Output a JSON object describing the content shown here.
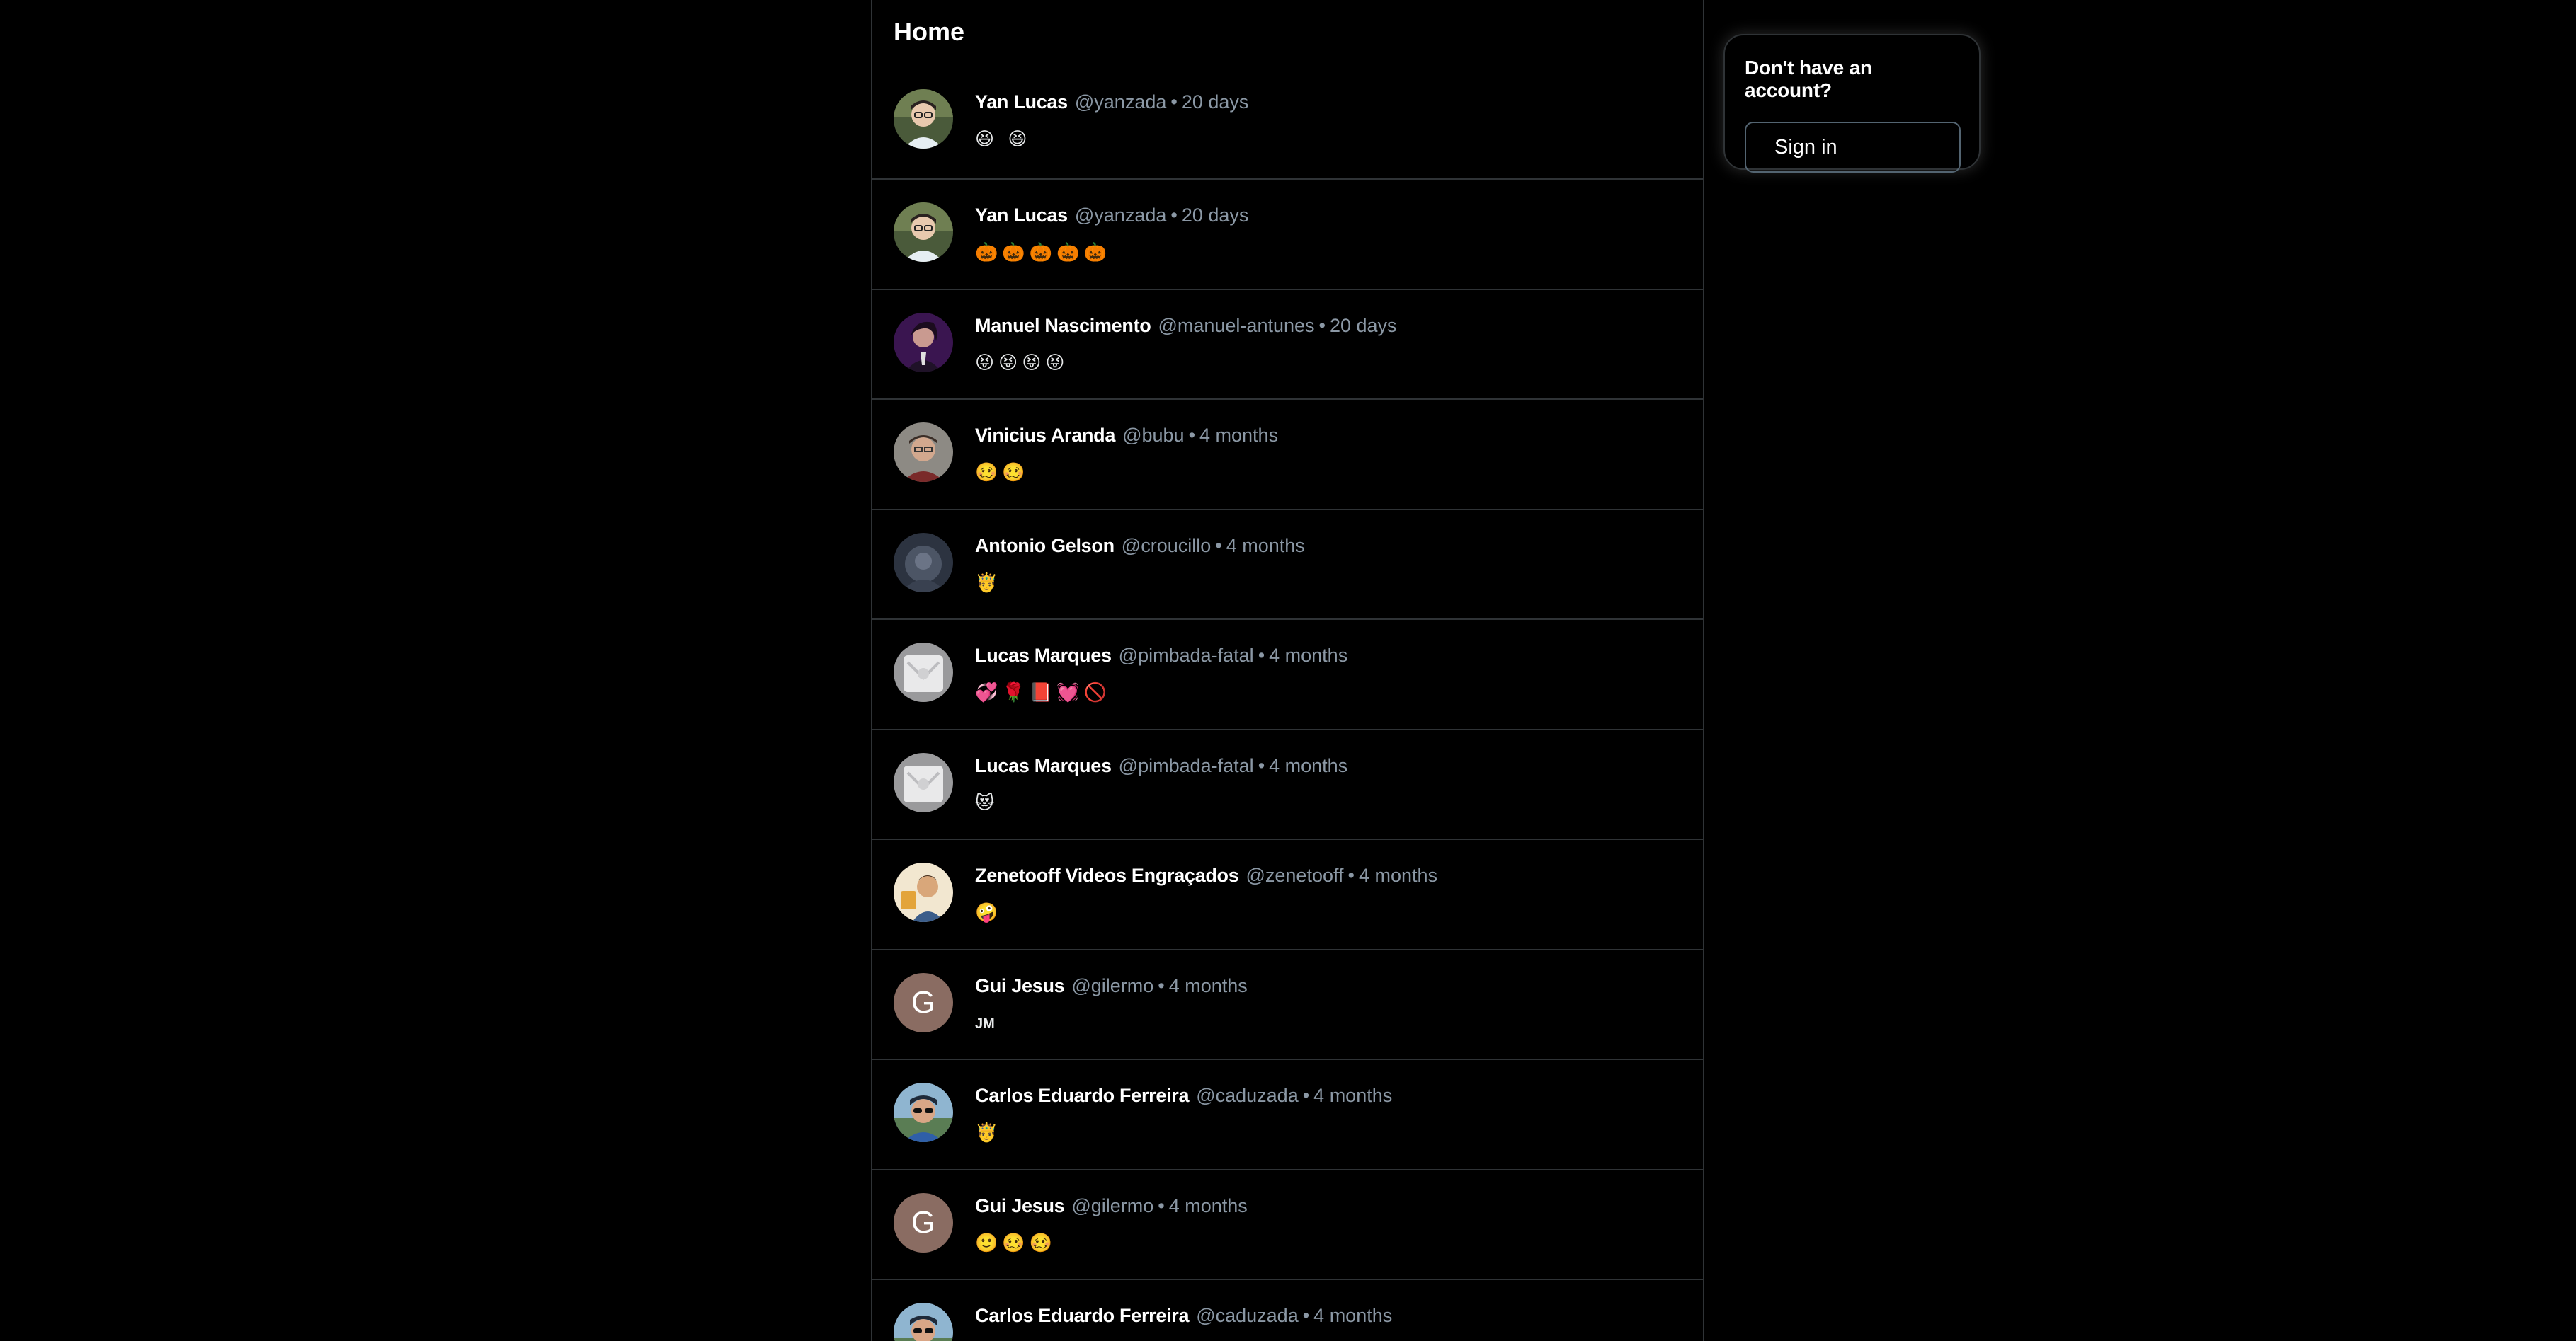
{
  "feed": {
    "title": "Home",
    "posts": [
      {
        "name": "Yan Lucas",
        "handle": "@yanzada",
        "separator": "•",
        "time": "20 days",
        "body": "😆 😆",
        "avatar": "photo-glasses"
      },
      {
        "name": "Yan Lucas",
        "handle": "@yanzada",
        "separator": "•",
        "time": "20 days",
        "body": "🎃🎃🎃🎃🎃",
        "avatar": "photo-glasses"
      },
      {
        "name": "Manuel Nascimento",
        "handle": "@manuel-antunes",
        "separator": "•",
        "time": "20 days",
        "body": "😝😝😝😝",
        "avatar": "photo-purple"
      },
      {
        "name": "Vinicius Aranda",
        "handle": "@bubu",
        "separator": "•",
        "time": "4 months",
        "body": "🥴🥴",
        "avatar": "photo-man"
      },
      {
        "name": "Antonio Gelson",
        "handle": "@croucillo",
        "separator": "•",
        "time": "4 months",
        "body": "🤴",
        "avatar": "photo-dark"
      },
      {
        "name": "Lucas Marques",
        "handle": "@pimbada-fatal",
        "separator": "•",
        "time": "4 months",
        "body": "💞🌹📕💓🚫",
        "avatar": "photo-grey"
      },
      {
        "name": "Lucas Marques",
        "handle": "@pimbada-fatal",
        "separator": "•",
        "time": "4 months",
        "body": "😻",
        "avatar": "photo-grey"
      },
      {
        "name": "Zenetooff Videos Engraçados",
        "handle": "@zenetooff",
        "separator": "•",
        "time": "4 months",
        "body": "🤪",
        "avatar": "photo-bright"
      },
      {
        "name": "Gui Jesus",
        "handle": "@gilermo",
        "separator": "•",
        "time": "4 months",
        "body": "JM",
        "avatar": "letter",
        "avatar_letter": "G",
        "small_text": true
      },
      {
        "name": "Carlos Eduardo Ferreira",
        "handle": "@caduzada",
        "separator": "•",
        "time": "4 months",
        "body": "🤴",
        "avatar": "photo-sunglasses"
      },
      {
        "name": "Gui Jesus",
        "handle": "@gilermo",
        "separator": "•",
        "time": "4 months",
        "body": "🙂🥴🥴",
        "avatar": "letter",
        "avatar_letter": "G"
      },
      {
        "name": "Carlos Eduardo Ferreira",
        "handle": "@caduzada",
        "separator": "•",
        "time": "4 months",
        "body": "",
        "avatar": "photo-sunglasses"
      }
    ]
  },
  "signin": {
    "title": "Don't have an account?",
    "button_label": "Sign in"
  },
  "colors": {
    "background": "#000000",
    "border": "#2f3336",
    "muted_text": "#8b98a5",
    "letter_avatar": "#8a6c62"
  }
}
